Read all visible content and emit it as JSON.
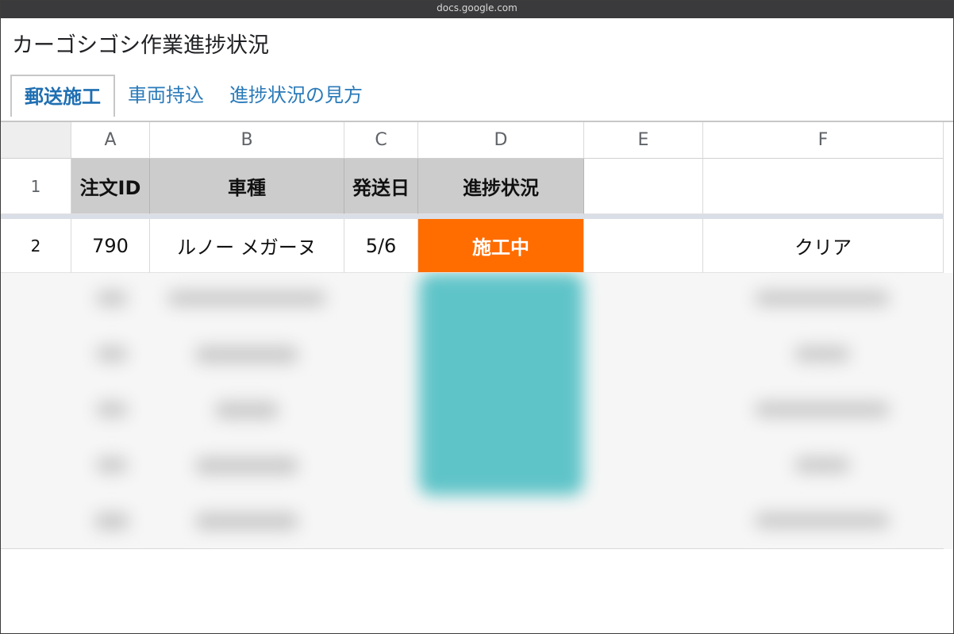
{
  "browser": {
    "url": "docs.google.com"
  },
  "document": {
    "title": "カーゴシゴシ作業進捗状況"
  },
  "tabs": [
    {
      "label": "郵送施工",
      "active": true
    },
    {
      "label": "車両持込",
      "active": false
    },
    {
      "label": "進捗状況の見方",
      "active": false
    }
  ],
  "sheet": {
    "column_letters": [
      "A",
      "B",
      "C",
      "D",
      "E",
      "F"
    ],
    "header_row": {
      "row_number": "1",
      "cells": [
        "注文ID",
        "車種",
        "発送日",
        "進捗状況",
        "",
        ""
      ]
    },
    "data_rows": [
      {
        "row_number": "2",
        "cells": [
          "790",
          "ルノー メガーヌ",
          "5/6",
          "施工中",
          "",
          "クリア"
        ],
        "status_color": "#ff6d01"
      }
    ]
  },
  "colors": {
    "url_bar": "#3a3a3c",
    "header_fill": "#cccccc",
    "status_in_progress": "#ff6d01",
    "status_blurred": "#5fc4c8",
    "tab_link": "#2a7ab9"
  }
}
